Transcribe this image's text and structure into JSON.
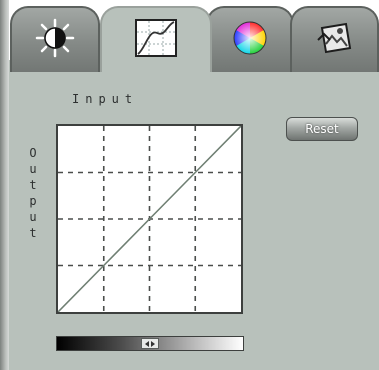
{
  "tabs": [
    {
      "name": "brightness-contrast",
      "icon": "brightness-contrast-icon",
      "active": false
    },
    {
      "name": "curves",
      "icon": "curve-graph-icon",
      "active": true
    },
    {
      "name": "color-balance",
      "icon": "color-wheel-icon",
      "active": false
    },
    {
      "name": "image-edit",
      "icon": "image-tools-icon",
      "active": false
    }
  ],
  "curves": {
    "input_label": "Input",
    "output_letters": [
      "O",
      "u",
      "t",
      "p",
      "u",
      "t"
    ],
    "reset_label": "Reset",
    "grid_divisions": 4,
    "curve_points": [
      [
        0,
        0
      ],
      [
        0.25,
        0.25
      ],
      [
        0.5,
        0.5
      ],
      [
        0.75,
        0.75
      ],
      [
        1,
        1
      ]
    ]
  },
  "gradient_slider": {
    "value": 0.5
  },
  "colors": {
    "panel": "#b8c1bb",
    "tab_inactive": "#858a87",
    "graph_line": "#6f7f73",
    "grid_dash": "#4a4d4b"
  }
}
